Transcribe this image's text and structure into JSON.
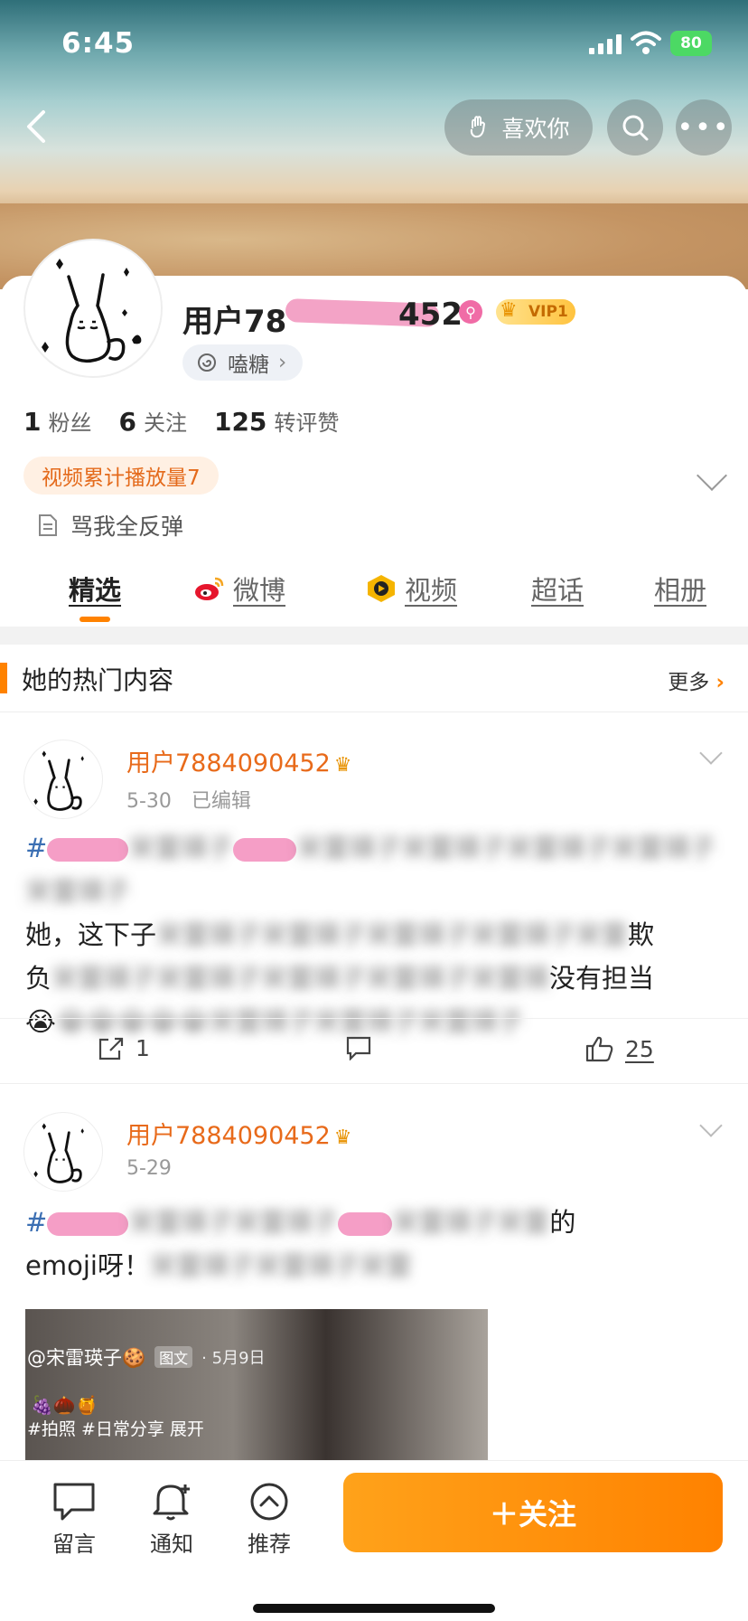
{
  "status": {
    "time": "6:45",
    "battery": "80"
  },
  "header": {
    "like_label": "喜欢你"
  },
  "profile": {
    "name_start": "用户78",
    "name_end": "452",
    "vip": "VIP1",
    "tang_label": "嗑糖",
    "stats": [
      {
        "num": "1",
        "label": "粉丝"
      },
      {
        "num": "6",
        "label": "关注"
      },
      {
        "num": "125",
        "label": "转评赞"
      }
    ],
    "video_badge": "视频累计播放量7",
    "bio": "骂我全反弹"
  },
  "tabs": [
    "精选",
    "微博",
    "视频",
    "超话",
    "相册"
  ],
  "hot": {
    "title": "她的热门内容",
    "more": "更多"
  },
  "posts": [
    {
      "author": "用户7884090452",
      "meta": "5-30　已编辑",
      "text_line2_a": "她，这下子",
      "text_line2_b": "欺",
      "text_line3_a": "负",
      "text_line3_b": "没有担当",
      "repost_count": "1",
      "like_count": "25"
    },
    {
      "author": "用户7884090452",
      "meta": "5-29",
      "text_line1_a": "#",
      "text_line1_b": "的",
      "text_line2": "emoji呀！",
      "image_overlay_user": "@宋雷瑛子🍪",
      "image_overlay_tag": "图文",
      "image_overlay_date": "· 5月9日",
      "image_overlay_emoji": "🍇🌰🍯",
      "image_overlay_tags": "#拍照 #日常分享  展开"
    }
  ],
  "bottom": {
    "items": [
      "留言",
      "通知",
      "推荐"
    ],
    "follow": "＋关注"
  }
}
